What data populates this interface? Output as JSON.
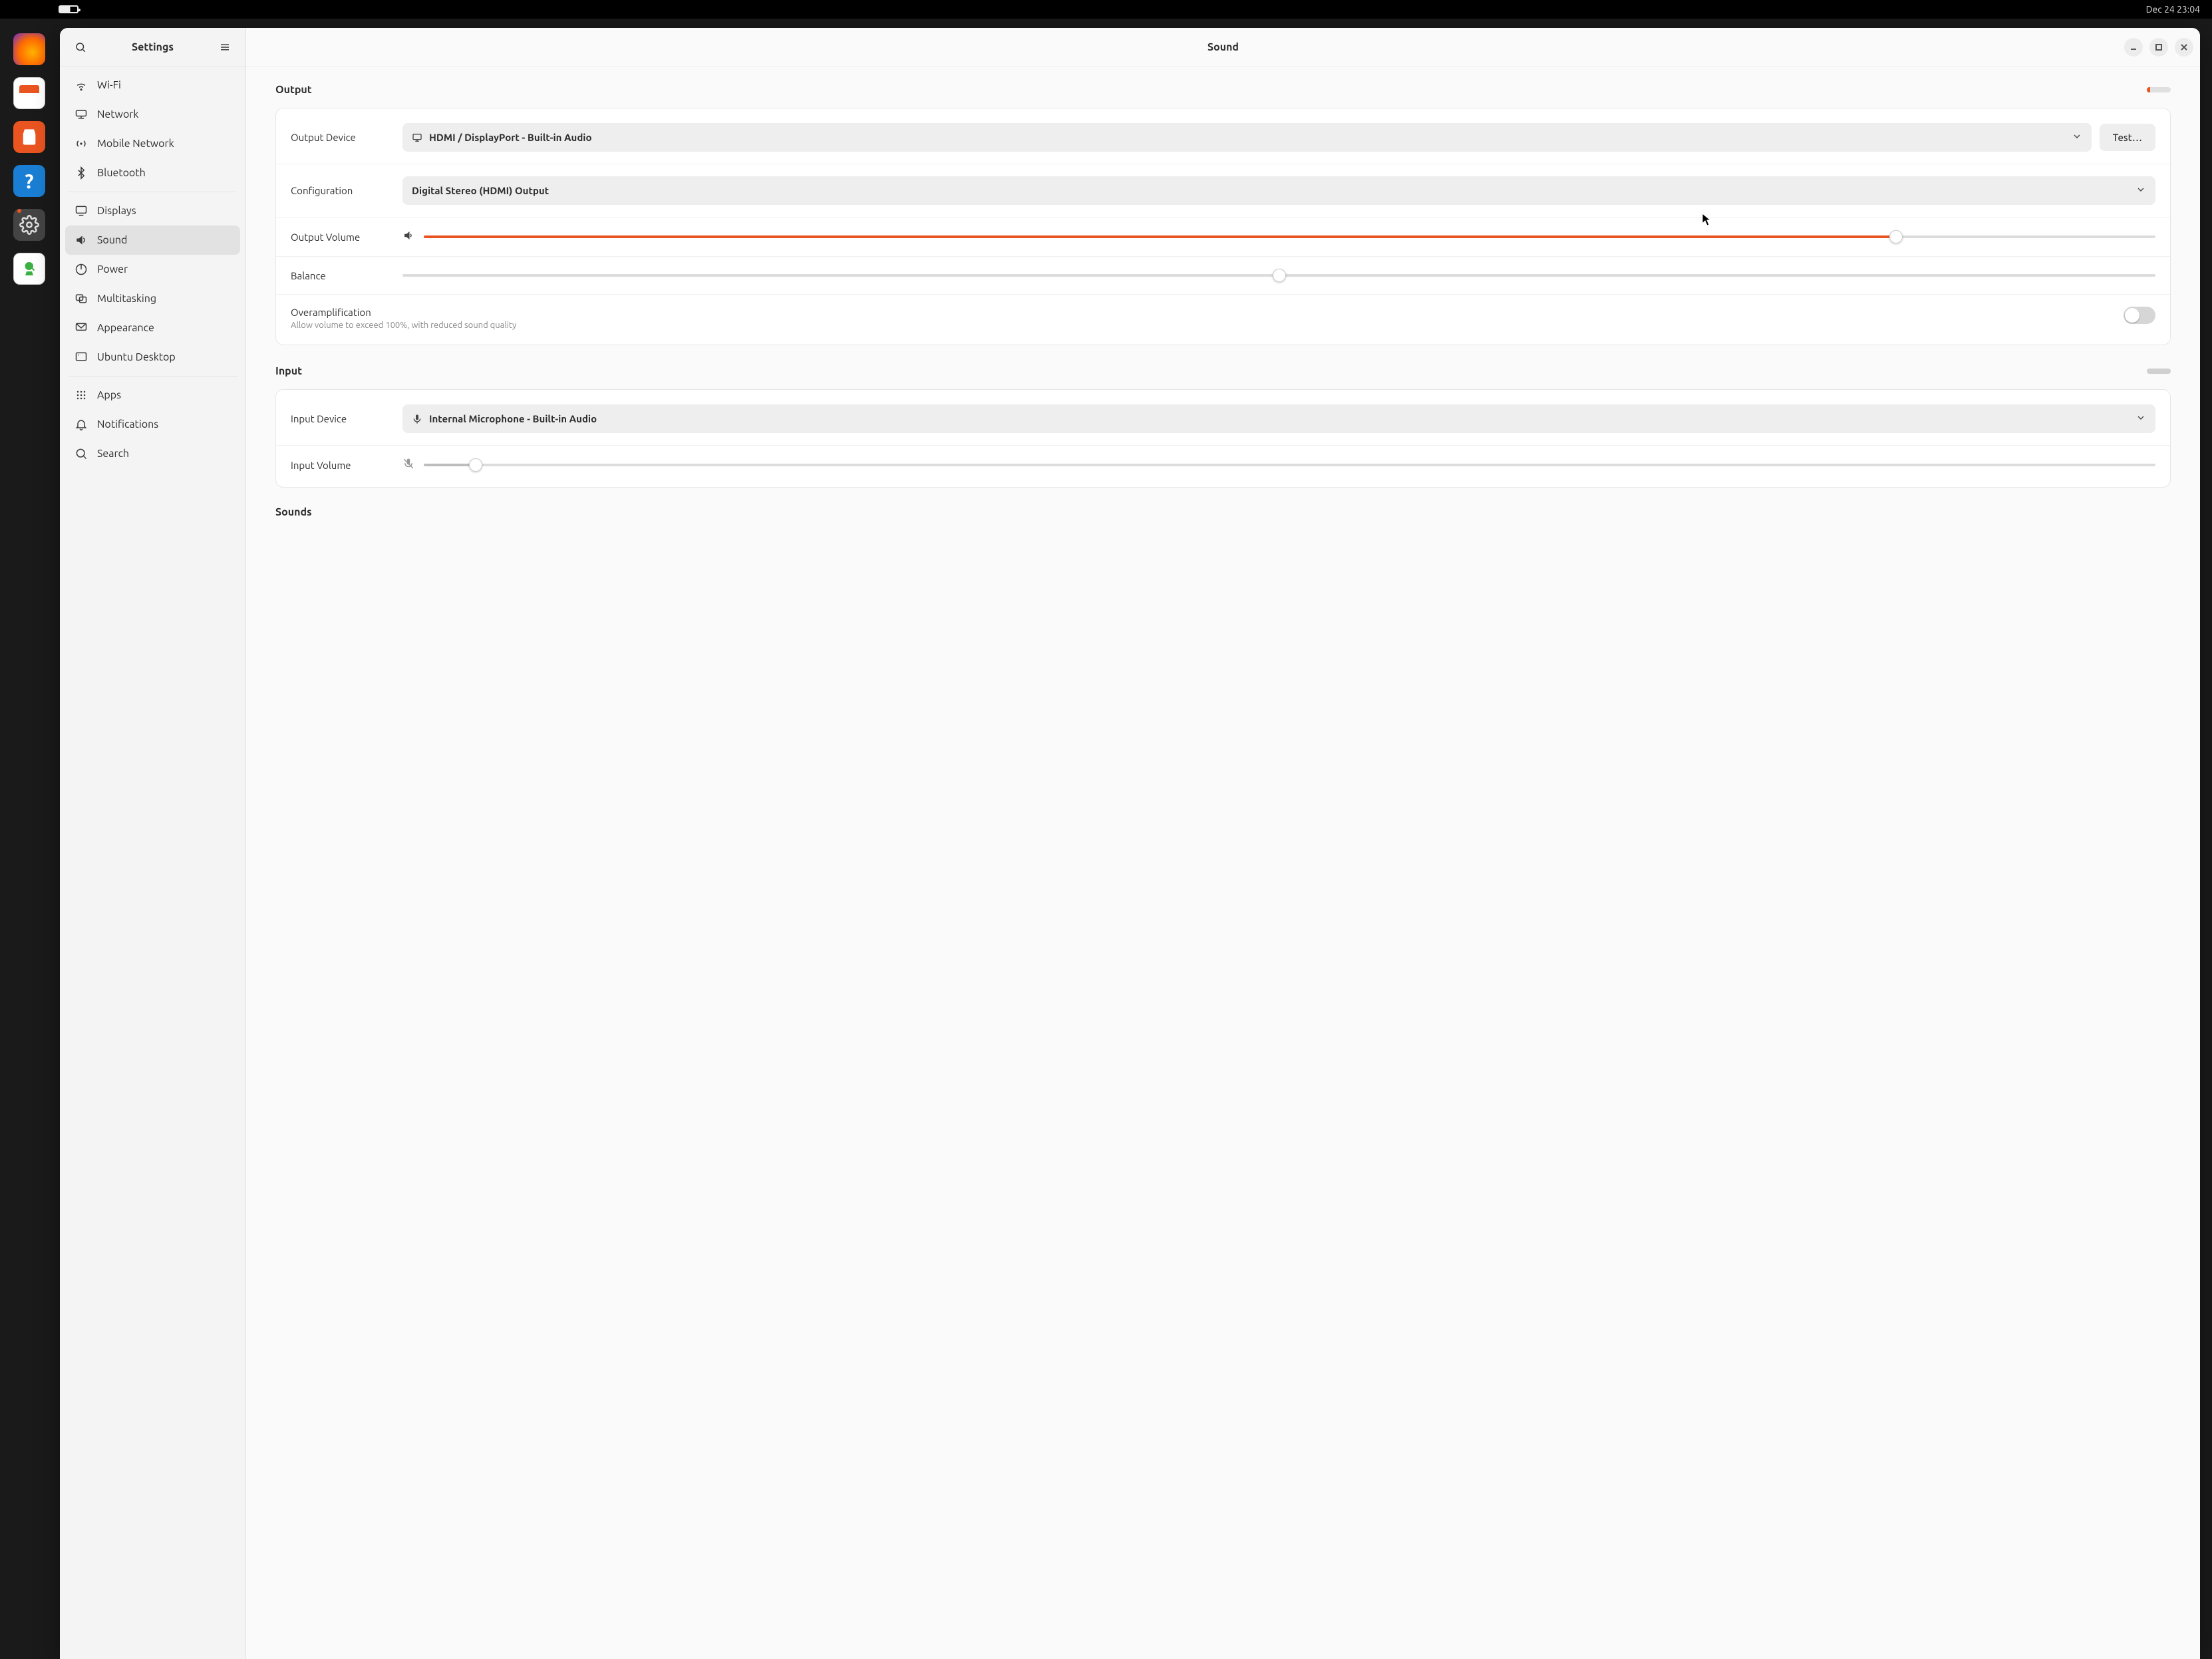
{
  "panel": {
    "clock": "Dec 24  23:04"
  },
  "sidebar": {
    "title": "Settings",
    "items": [
      {
        "label": "Wi-Fi"
      },
      {
        "label": "Network"
      },
      {
        "label": "Mobile Network"
      },
      {
        "label": "Bluetooth"
      },
      {
        "label": "Displays"
      },
      {
        "label": "Sound"
      },
      {
        "label": "Power"
      },
      {
        "label": "Multitasking"
      },
      {
        "label": "Appearance"
      },
      {
        "label": "Ubuntu Desktop"
      },
      {
        "label": "Apps"
      },
      {
        "label": "Notifications"
      },
      {
        "label": "Search"
      }
    ]
  },
  "page": {
    "title": "Sound"
  },
  "output": {
    "heading": "Output",
    "level_percent": 15,
    "device_label": "Output Device",
    "device_value": "HDMI / DisplayPort - Built-in Audio",
    "test_button": "Test…",
    "config_label": "Configuration",
    "config_value": "Digital Stereo (HDMI) Output",
    "volume_label": "Output Volume",
    "volume_percent": 85,
    "balance_label": "Balance",
    "balance_percent": 50,
    "overamp_title": "Overamplification",
    "overamp_sub": "Allow volume to exceed 100%, with reduced sound quality",
    "overamp_on": false
  },
  "input": {
    "heading": "Input",
    "level_percent": 0,
    "device_label": "Input Device",
    "device_value": "Internal Microphone - Built-in Audio",
    "volume_label": "Input Volume",
    "volume_percent": 3
  },
  "sounds": {
    "heading": "Sounds"
  },
  "colors": {
    "accent": "#e95420"
  }
}
